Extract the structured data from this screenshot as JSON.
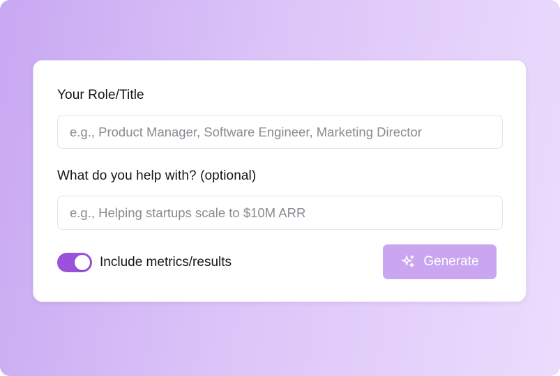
{
  "form": {
    "role_label": "Your Role/Title",
    "role_placeholder": "e.g., Product Manager, Software Engineer, Marketing Director",
    "help_label": "What do you help with? (optional)",
    "help_placeholder": "e.g., Helping startups scale to $10M ARR",
    "metrics_toggle": {
      "label": "Include metrics/results",
      "checked": true
    },
    "generate_button": {
      "label": "Generate",
      "icon": "sparkles-icon"
    }
  },
  "colors": {
    "accent": "#9a52dc",
    "button_disabled": "#c9a6ef",
    "background_gradient": [
      "#c8a8f2",
      "#ecdcfd"
    ]
  }
}
